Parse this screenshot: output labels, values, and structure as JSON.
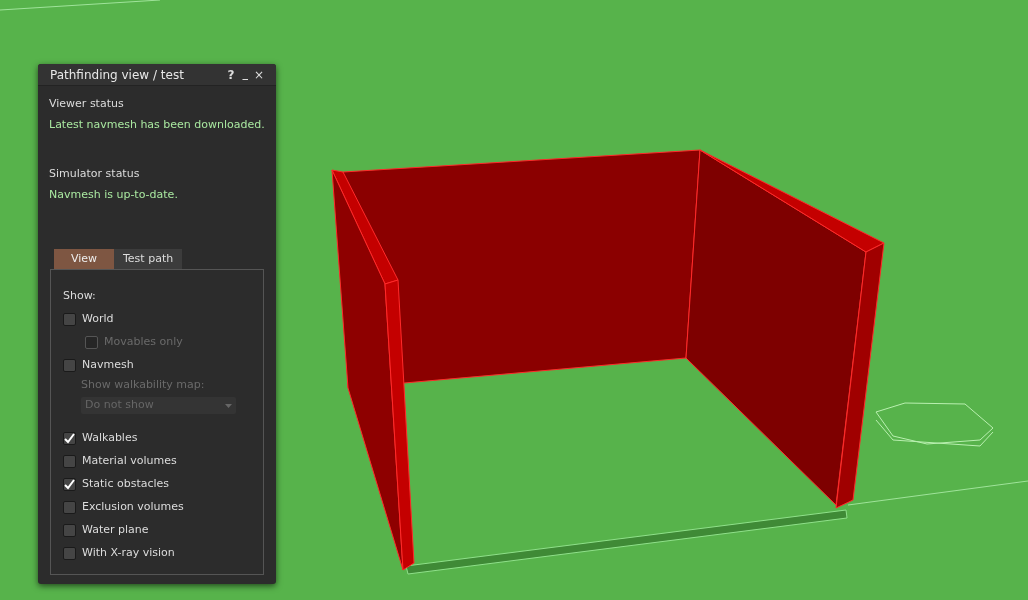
{
  "window": {
    "title": "Pathfinding view / test",
    "help": "?",
    "minimize": "_",
    "close": "×"
  },
  "viewer_status": {
    "label": "Viewer status",
    "value": "Latest navmesh has been downloaded."
  },
  "simulator_status": {
    "label": "Simulator status",
    "value": "Navmesh is up-to-date."
  },
  "tabs": [
    {
      "label": "View",
      "selected": true
    },
    {
      "label": "Test path",
      "selected": false
    }
  ],
  "options": [
    {
      "kind": "label",
      "text": "Show:",
      "disabled": false
    },
    {
      "kind": "checkbox",
      "text": "World",
      "checked": false
    },
    {
      "kind": "subcheckbox",
      "text": "Movables only",
      "checked": false,
      "disabled": true
    },
    {
      "kind": "checkbox",
      "text": "Navmesh",
      "checked": false
    },
    {
      "kind": "label",
      "text": "Show walkability map:",
      "disabled": true
    },
    {
      "kind": "dropdown",
      "text": "Do not show",
      "disabled": true
    },
    {
      "kind": "checkbox",
      "text": "Walkables",
      "checked": true
    },
    {
      "kind": "checkbox",
      "text": "Material volumes",
      "checked": false
    },
    {
      "kind": "checkbox",
      "text": "Static obstacles",
      "checked": true
    },
    {
      "kind": "checkbox",
      "text": "Exclusion volumes",
      "checked": false
    },
    {
      "kind": "checkbox",
      "text": "Water plane",
      "checked": false
    },
    {
      "kind": "checkbox",
      "text": "With X-ray vision",
      "checked": false
    }
  ]
}
